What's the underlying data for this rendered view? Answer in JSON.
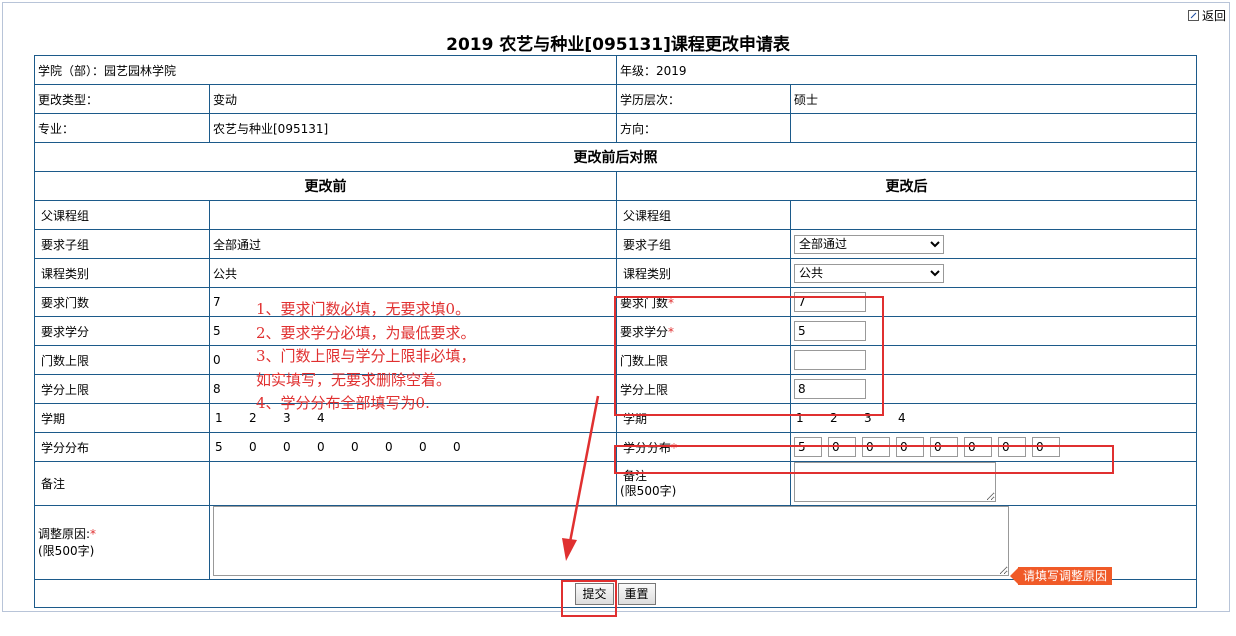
{
  "header": {
    "back_label": "返回",
    "title": "2019 农艺与种业[095131]课程更改申请表"
  },
  "info": {
    "college": "学院（部）：园艺园林学院",
    "grade": "年级：2019",
    "change_type_label": "更改类型：",
    "change_type_value": "变动",
    "edu_level_label": "学历层次：",
    "edu_level_value": "硕士",
    "major_label": "专业：",
    "major_value": "农艺与种业[095131]",
    "direction_label": "方向："
  },
  "compare": {
    "section_title": "更改前后对照",
    "before_title": "更改前",
    "after_title": "更改后"
  },
  "labels": {
    "parent_group": "父课程组",
    "sub_group": "要求子组",
    "course_category": "课程类别",
    "req_count": "要求门数",
    "req_credit": "要求学分",
    "count_upper": "门数上限",
    "credit_upper": "学分上限",
    "term": "学期",
    "credit_dist": "学分分布",
    "remark": "备注",
    "remark_limit": "(限500字)",
    "reason": "调整原因:",
    "reason_limit": "(限500字)",
    "required_mark": "*"
  },
  "before": {
    "parent_group": "",
    "sub_group": "全部通过",
    "course_category": "公共",
    "req_count": "7",
    "req_credit": "5",
    "count_upper": "0",
    "credit_upper": "8",
    "terms": [
      "1",
      "2",
      "3",
      "4"
    ],
    "dist": [
      "5",
      "0",
      "0",
      "0",
      "0",
      "0",
      "0",
      "0"
    ]
  },
  "after": {
    "sub_group": "全部通过",
    "course_category": "公共",
    "req_count": "7",
    "req_credit": "5",
    "count_upper": "",
    "credit_upper": "8",
    "terms": [
      "1",
      "2",
      "3",
      "4"
    ],
    "dist": [
      "5",
      "0",
      "0",
      "0",
      "0",
      "0",
      "0",
      "0"
    ]
  },
  "buttons": {
    "submit": "提交",
    "reset": "重置"
  },
  "annotation": {
    "line1": "1、要求门数必填，无要求填0。",
    "line2": "2、要求学分必填，为最低要求。",
    "line3": "3、门数上限与学分上限非必填，",
    "line4": "如实填写，无要求删除空着。",
    "line5": "4、学分分布全部填写为0."
  },
  "tooltip": "请填写调整原因",
  "colors": {
    "border": "#1c5a8a",
    "annotation_red": "#e03030",
    "tooltip_bg": "#f05a28"
  }
}
